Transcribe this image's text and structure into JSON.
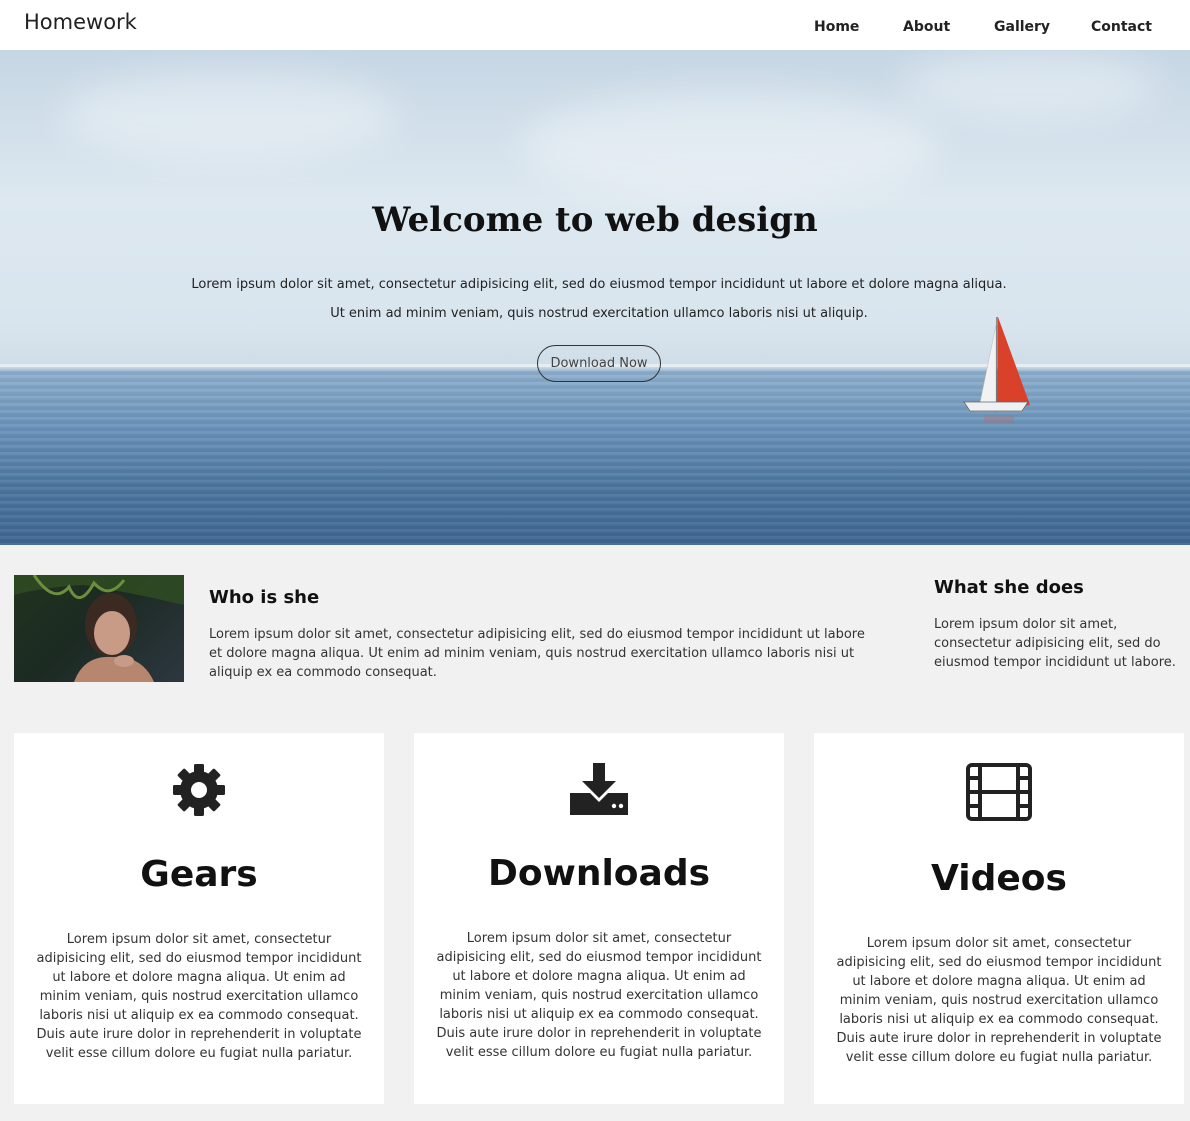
{
  "nav": {
    "brand": "Homework",
    "links": [
      "Home",
      "About",
      "Gallery",
      "Contact"
    ]
  },
  "hero": {
    "title": "Welcome to web design",
    "line1": "Lorem ipsum dolor sit amet, consectetur adipisicing elit, sed do eiusmod tempor incididunt ut labore et dolore magna aliqua.",
    "line2": "Ut enim ad minim veniam, quis nostrud exercitation ullamco laboris nisi ut aliquip.",
    "button": "Download Now"
  },
  "about": {
    "who_title": "Who is she",
    "who_text": "Lorem ipsum dolor sit amet, consectetur adipisicing elit, sed do eiusmod tempor incididunt ut labore et dolore magna aliqua. Ut enim ad minim veniam, quis nostrud exercitation ullamco laboris nisi ut aliquip ex ea commodo consequat.",
    "does_title": "What she does",
    "does_text": "Lorem ipsum dolor sit amet, consectetur adipisicing elit, sed do eiusmod tempor incididunt ut labore."
  },
  "cards": [
    {
      "icon": "gear-icon",
      "title": "Gears",
      "text": "Lorem ipsum dolor sit amet, consectetur adipisicing elit, sed do eiusmod tempor incididunt ut labore et dolore magna aliqua. Ut enim ad minim veniam, quis nostrud exercitation ullamco laboris nisi ut aliquip ex ea commodo consequat. Duis aute irure dolor in reprehenderit in voluptate velit esse cillum dolore eu fugiat nulla pariatur."
    },
    {
      "icon": "download-icon",
      "title": "Downloads",
      "text": "Lorem ipsum dolor sit amet, consectetur adipisicing elit, sed do eiusmod tempor incididunt ut labore et dolore magna aliqua. Ut enim ad minim veniam, quis nostrud exercitation ullamco laboris nisi ut aliquip ex ea commodo consequat. Duis aute irure dolor in reprehenderit in voluptate velit esse cillum dolore eu fugiat nulla pariatur."
    },
    {
      "icon": "film-icon",
      "title": "Videos",
      "text": "Lorem ipsum dolor sit amet, consectetur adipisicing elit, sed do eiusmod tempor incididunt ut labore et dolore magna aliqua. Ut enim ad minim veniam, quis nostrud exercitation ullamco laboris nisi ut aliquip ex ea commodo consequat. Duis aute irure dolor in reprehenderit in voluptate velit esse cillum dolore eu fugiat nulla pariatur."
    }
  ],
  "colors": {
    "page_bg": "#f1f1f1",
    "card_bg": "#ffffff",
    "text": "#111111",
    "sail": "#d9412a"
  }
}
